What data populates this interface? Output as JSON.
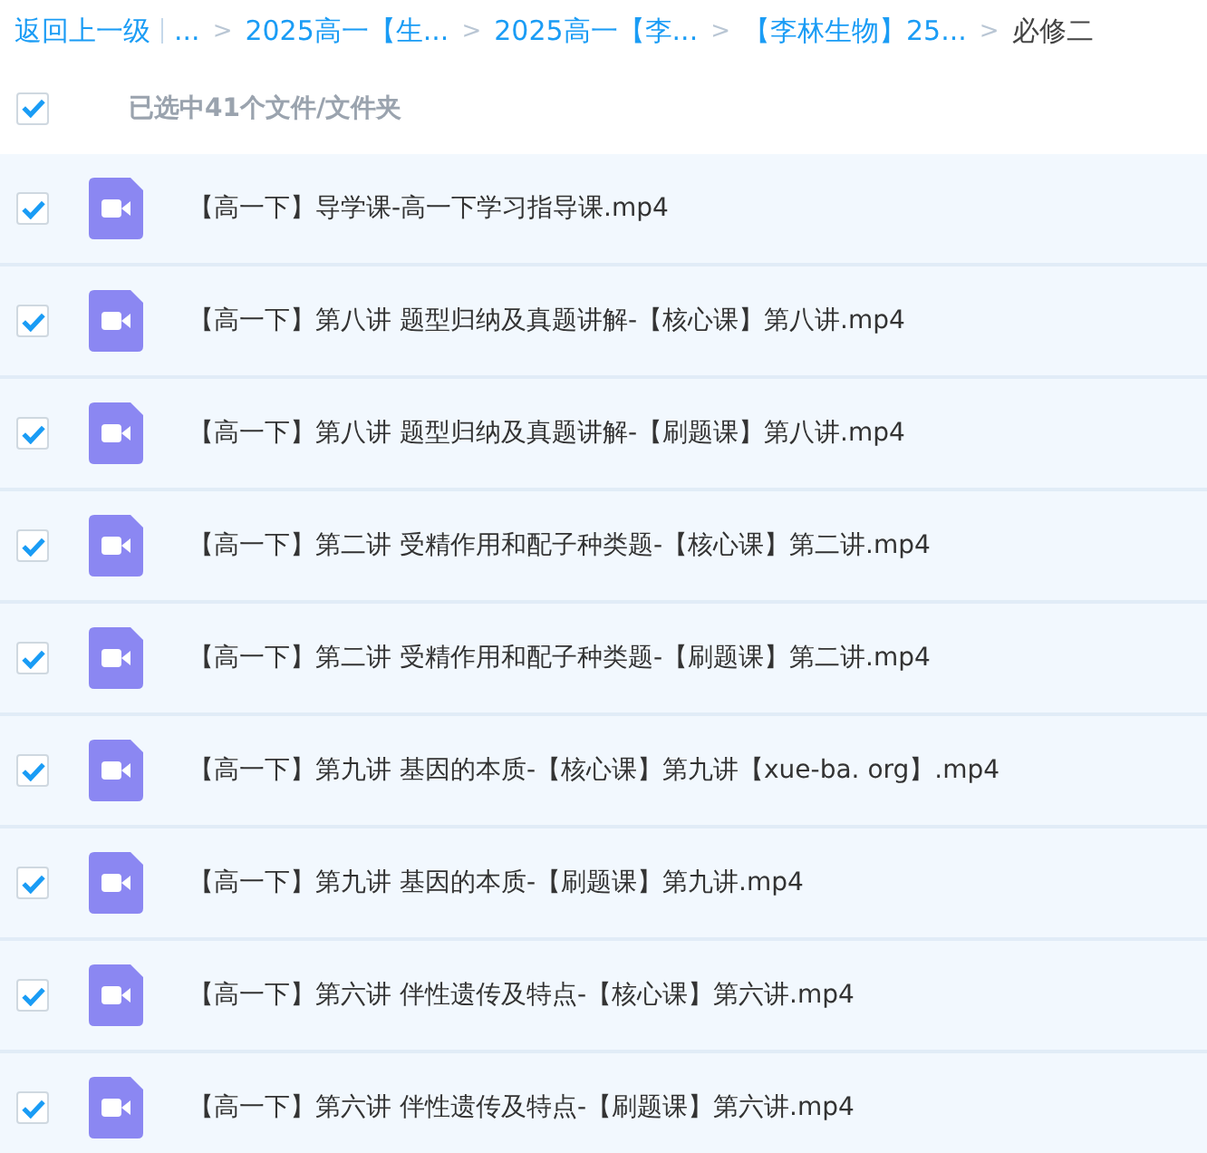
{
  "breadcrumb": {
    "back": "返回上一级",
    "separator": ">",
    "items": [
      {
        "label": "...",
        "current": false
      },
      {
        "label": "2025高一【生...",
        "current": false
      },
      {
        "label": "2025高一【李...",
        "current": false
      },
      {
        "label": "【李林生物】25...",
        "current": false
      },
      {
        "label": "必修二",
        "current": true
      }
    ]
  },
  "select_all": {
    "checked": true,
    "label": "已选中41个文件/文件夹"
  },
  "files": [
    {
      "name": "【高一下】导学课-高一下学习指导课.mp4",
      "checked": true
    },
    {
      "name": "【高一下】第八讲 题型归纳及真题讲解-【核心课】第八讲.mp4",
      "checked": true
    },
    {
      "name": "【高一下】第八讲 题型归纳及真题讲解-【刷题课】第八讲.mp4",
      "checked": true
    },
    {
      "name": "【高一下】第二讲 受精作用和配子种类题-【核心课】第二讲.mp4",
      "checked": true
    },
    {
      "name": "【高一下】第二讲 受精作用和配子种类题-【刷题课】第二讲.mp4",
      "checked": true
    },
    {
      "name": "【高一下】第九讲 基因的本质-【核心课】第九讲【xue-ba. org】.mp4",
      "checked": true
    },
    {
      "name": "【高一下】第九讲 基因的本质-【刷题课】第九讲.mp4",
      "checked": true
    },
    {
      "name": "【高一下】第六讲 伴性遗传及特点-【核心课】第六讲.mp4",
      "checked": true
    },
    {
      "name": "【高一下】第六讲 伴性遗传及特点-【刷题课】第六讲.mp4",
      "checked": true
    }
  ]
}
